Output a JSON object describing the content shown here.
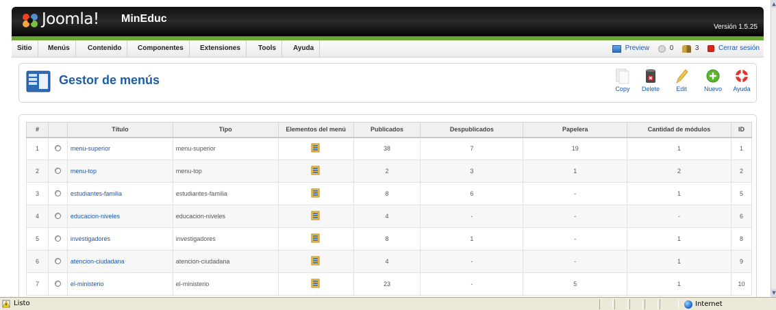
{
  "header": {
    "logo_text": "Joomla!",
    "site_name": "MinEduc",
    "version": "Versión 1.5.25"
  },
  "menubar": {
    "items": [
      "Sitio",
      "Menús",
      "Contenido",
      "Componentes",
      "Extensiones",
      "Tools",
      "Ayuda"
    ],
    "preview": "Preview",
    "messages_count": "0",
    "users_count": "3",
    "logout": "Cerrar sesión"
  },
  "toolbar": {
    "title": "Gestor de menús",
    "buttons": {
      "copy": "Copy",
      "delete": "Delete",
      "edit": "Edit",
      "new": "Nuevo",
      "help": "Ayuda"
    }
  },
  "table": {
    "headers": {
      "num": "#",
      "title": "Título",
      "type": "Tipo",
      "items": "Elementos del menú",
      "published": "Publicados",
      "unpublished": "Despublicados",
      "trash": "Papelera",
      "modules": "Cantidad de módulos",
      "id": "ID"
    },
    "rows": [
      {
        "num": "1",
        "title": "menu-superior",
        "type": "menu-superior",
        "published": "38",
        "unpublished": "7",
        "trash": "19",
        "modules": "1",
        "id": "1"
      },
      {
        "num": "2",
        "title": "menu-top",
        "type": "menu-top",
        "published": "2",
        "unpublished": "3",
        "trash": "1",
        "modules": "2",
        "id": "2"
      },
      {
        "num": "3",
        "title": "estudiantes-familia",
        "type": "estudiantes-familia",
        "published": "8",
        "unpublished": "6",
        "trash": "-",
        "modules": "1",
        "id": "5"
      },
      {
        "num": "4",
        "title": "educacion-niveles",
        "type": "educacion-niveles",
        "published": "4",
        "unpublished": "-",
        "trash": "-",
        "modules": "-",
        "id": "6"
      },
      {
        "num": "5",
        "title": "investigadores",
        "type": "investigadores",
        "published": "8",
        "unpublished": "1",
        "trash": "-",
        "modules": "1",
        "id": "8"
      },
      {
        "num": "6",
        "title": "atencion-ciudadana",
        "type": "atencion-ciudadana",
        "published": "4",
        "unpublished": "-",
        "trash": "-",
        "modules": "1",
        "id": "9"
      },
      {
        "num": "7",
        "title": "el-ministerio",
        "type": "el-ministerio",
        "published": "23",
        "unpublished": "-",
        "trash": "5",
        "modules": "1",
        "id": "10"
      }
    ]
  },
  "statusbar": {
    "status": "Listo",
    "zone": "Internet"
  }
}
